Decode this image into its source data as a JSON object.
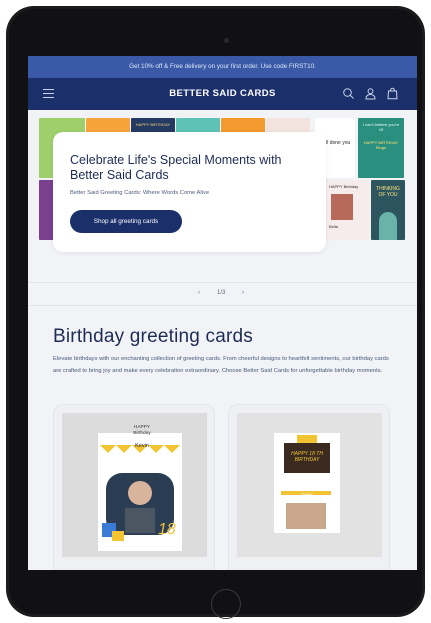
{
  "announcement": "Get 10% off & Free delivery on your first order. Use code FIRST10.",
  "header": {
    "logo": "BETTER SAID CARDS",
    "icons": [
      "menu-icon",
      "search-icon",
      "user-icon",
      "bag-icon"
    ]
  },
  "hero": {
    "title": "Celebrate Life's Special Moments with Better Said Cards",
    "subtitle": "Better Said Greeting Cards: Where Words Come Alive",
    "cta": "Shop all greeting cards",
    "slideshow": {
      "prev": "‹",
      "counter": "1/3",
      "next": "›"
    },
    "tiles": [
      {
        "text": "HAPPY BIRTHDAY",
        "color": "#2c3a5c"
      },
      {
        "text": "well done you",
        "color": "#ffffff"
      },
      {
        "text": "I can't believe you're 18",
        "color": "#2b8f7f"
      },
      {
        "text": "HAPPY BIRTHDAY Ringo",
        "color": "#2b8f7f"
      },
      {
        "text": "HAPPY Birthday",
        "color": "#f6ecec"
      },
      {
        "text": "THINKING OF YOU",
        "color": "#2c5560"
      },
      {
        "text": "Bella",
        "color": "#f3e6e6"
      }
    ]
  },
  "collection": {
    "title": "Birthday greeting cards",
    "description": "Elevate birthdays with our enchanting collection of greeting cards. From cheerful designs to heartfelt sentiments, our birthday cards are crafted to bring joy and make every celebration extraordinary. Choose Better Said Cards for unforgettable birthday moments.",
    "products": [
      {
        "card_heading": "HAPPY Birthday",
        "name": "Kevin",
        "number": "18"
      },
      {
        "card_heading": "HAPPY 18 TH BIRTHDAY",
        "name": "Kevin"
      }
    ]
  },
  "colors": {
    "announcement_bg": "#3a5aa8",
    "header_bg": "#1b2f6b",
    "button_bg": "#1b2f6b",
    "text_dark": "#1e2c55",
    "page_bg": "#f1f3f6"
  }
}
